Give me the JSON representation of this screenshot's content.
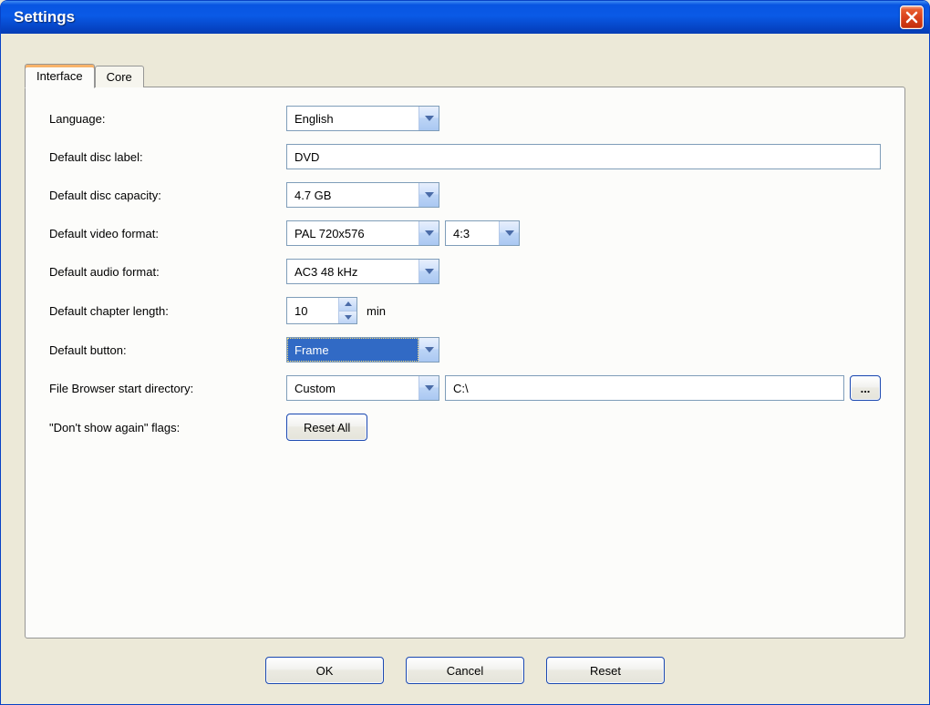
{
  "window": {
    "title": "Settings"
  },
  "tabs": {
    "interface": "Interface",
    "core": "Core"
  },
  "labels": {
    "language": "Language:",
    "disc_label": "Default disc label:",
    "disc_capacity": "Default disc capacity:",
    "video_format": "Default video format:",
    "audio_format": "Default audio format:",
    "chapter_length": "Default chapter length:",
    "default_button": "Default button:",
    "browser_dir": "File Browser start directory:",
    "flags": "\"Don't show again\" flags:",
    "min": "min"
  },
  "values": {
    "language": "English",
    "disc_label": "DVD",
    "disc_capacity": "4.7 GB",
    "video_format": "PAL 720x576",
    "aspect_ratio": "4:3",
    "audio_format": "AC3 48 kHz",
    "chapter_length": "10",
    "default_button": "Frame",
    "browser_mode": "Custom",
    "browser_path": "C:\\"
  },
  "buttons": {
    "reset_all": "Reset All",
    "browse": "...",
    "ok": "OK",
    "cancel": "Cancel",
    "reset": "Reset"
  }
}
